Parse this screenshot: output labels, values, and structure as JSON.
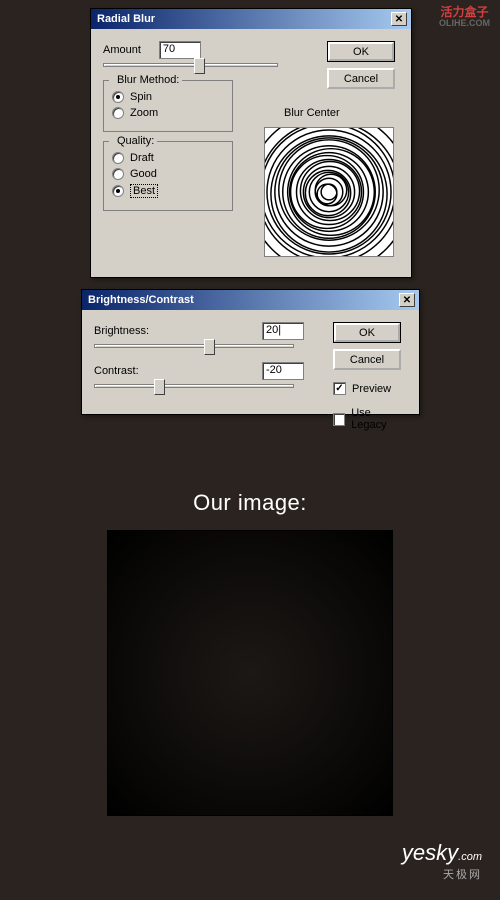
{
  "watermarks": {
    "top": "活力盒子",
    "top_sub": "OLIHE.COM",
    "bottom": "yesky",
    "bottom_sm": ".com",
    "bottom_cn": "天极网"
  },
  "radial": {
    "title": "Radial Blur",
    "close": "✕",
    "ok": "OK",
    "cancel": "Cancel",
    "amount_label": "Amount",
    "amount_value": "70",
    "method_label": "Blur Method:",
    "spin_label": "Spin",
    "zoom_label": "Zoom",
    "quality_label": "Quality:",
    "draft_label": "Draft",
    "good_label": "Good",
    "best_label": "Best",
    "center_label": "Blur Center"
  },
  "bc": {
    "title": "Brightness/Contrast",
    "close": "✕",
    "ok": "OK",
    "cancel": "Cancel",
    "brightness_label": "Brightness:",
    "brightness_value": "20",
    "contrast_label": "Contrast:",
    "contrast_value": "-20",
    "preview_label": "Preview",
    "legacy_label": "Use Legacy"
  },
  "heading": "Our image:"
}
